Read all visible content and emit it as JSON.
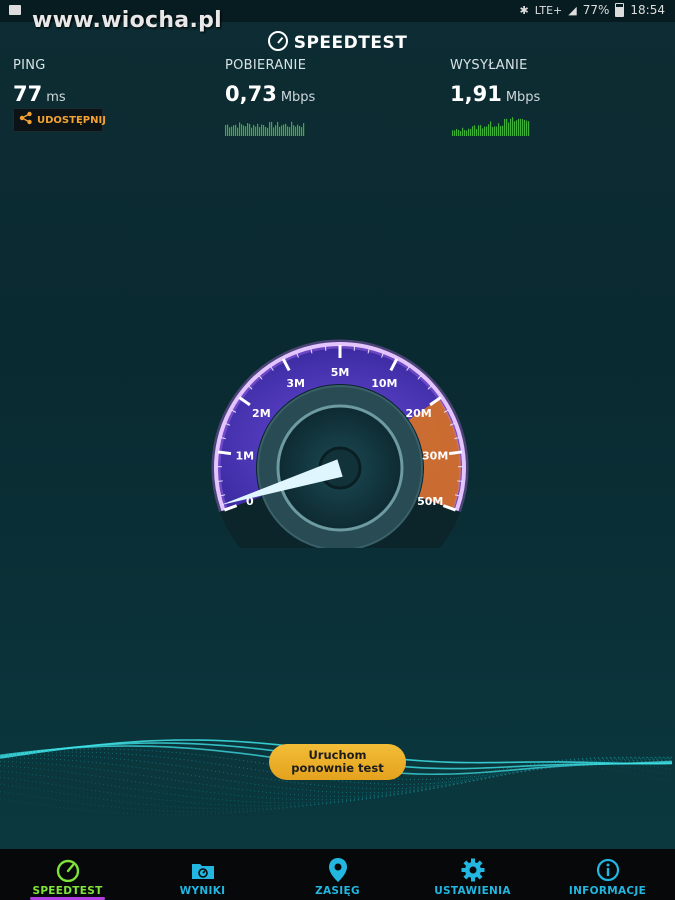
{
  "status_bar": {
    "watermark": "www.wiocha.pl",
    "network": "LTE+",
    "battery": "77%",
    "time": "18:54"
  },
  "app": {
    "title": "SPEEDTEST"
  },
  "metrics": {
    "ping": {
      "label": "PING",
      "value": "77",
      "unit": "ms"
    },
    "download": {
      "label": "POBIERANIE",
      "value": "0,73",
      "unit": "Mbps"
    },
    "upload": {
      "label": "WYSYŁANIE",
      "value": "1,91",
      "unit": "Mbps"
    }
  },
  "share_button": {
    "label": "UDOSTĘPNIJ",
    "icon": "share-icon"
  },
  "gauge": {
    "tick_labels": [
      "0",
      "1M",
      "2M",
      "3M",
      "5M",
      "10M",
      "20M",
      "30M",
      "50M"
    ],
    "needle_value_mbps": 0.1,
    "accent_color": "#b35ff0",
    "high_zone_color": "#e07a2a"
  },
  "restart_button": {
    "line1": "Uruchom",
    "line2": "ponownie test"
  },
  "nav": [
    {
      "label": "SPEEDTEST",
      "icon": "speedometer-icon",
      "active": true
    },
    {
      "label": "WYNIKI",
      "icon": "results-folder-icon",
      "active": false
    },
    {
      "label": "ZASIĘG",
      "icon": "location-pin-icon",
      "active": false
    },
    {
      "label": "USTAWIENIA",
      "icon": "gear-icon",
      "active": false
    },
    {
      "label": "INFORMACJE",
      "icon": "info-icon",
      "active": false
    }
  ],
  "colors": {
    "accent_green": "#7fe33a",
    "accent_blue": "#22b6e0",
    "button_yellow": "#f3bd37",
    "share_orange": "#f3a233"
  }
}
